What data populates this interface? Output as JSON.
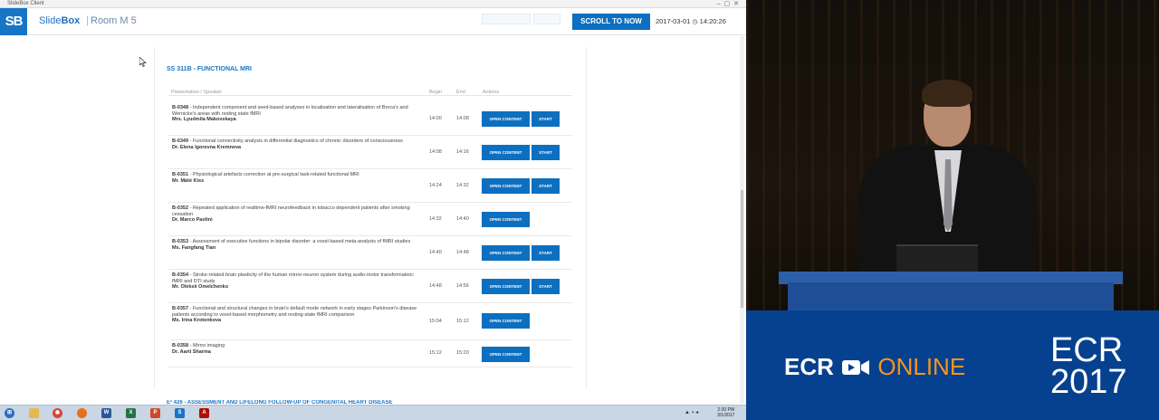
{
  "window": {
    "title": "SlideBox Client"
  },
  "header": {
    "logo": "SB",
    "app_name_prefix": "Slide",
    "app_name_suffix": "Box",
    "separator": "|",
    "room": "Room M 5",
    "scroll_button": "SCROLL TO NOW",
    "date": "2017-03-01",
    "clock_icon": "◷",
    "time": "14:20:26"
  },
  "session": {
    "title": "SS 311B - FUNCTIONAL MRI",
    "columns": [
      "Presentation / Speaker",
      "Begin",
      "End",
      "Actions"
    ],
    "open_label": "OPEN CONTENT",
    "start_label": "START",
    "rows": [
      {
        "code": "B-0348",
        "title": "Independent component and seed-based analyses in localisation and lateralisation of Broca's and Wernicke's areas with resting state fMRI",
        "speaker": "Mrs. Lyudmila Makovskaya",
        "begin": "14:00",
        "end": "14:08",
        "has_start": true
      },
      {
        "code": "B-0349",
        "title": "Functional connectivity analysis in differential diagnostics of chronic disorders of consciousness",
        "speaker": "Dr. Elena Igorevna Kremneva",
        "begin": "14:08",
        "end": "14:16",
        "has_start": true
      },
      {
        "code": "B-0351",
        "title": "Physiological artefacts correction at pre-surgical task-related functional MRI",
        "speaker": "Mr. Máté Kiss",
        "begin": "14:24",
        "end": "14:32",
        "has_start": true
      },
      {
        "code": "B-0352",
        "title": "Repeated application of realtime-fMRI neurofeedback in tobacco dependent patients after smoking cessation",
        "speaker": "Dr. Marco Paolini",
        "begin": "14:32",
        "end": "14:40",
        "has_start": false
      },
      {
        "code": "B-0353",
        "title": "Assessment of executive functions in bipolar disorder: a voxel-based meta-analysis of fMRI studies",
        "speaker": "Ms. Fangfang Tian",
        "begin": "14:40",
        "end": "14:48",
        "has_start": true
      },
      {
        "code": "B-0354",
        "title": "Stroke-related brain plasticity of the human mirror-neuron system during audio-motor transformation: fMRI and DTI study",
        "speaker": "Mr. Oleksii Omelchenko",
        "begin": "14:48",
        "end": "14:56",
        "has_start": true
      },
      {
        "code": "B-0357",
        "title": "Functional and structural changes in brain's default mode network in early stages Parkinson's disease patients according to voxel-based morphometry and resting-state fMRI comparison",
        "speaker": "Ms. Irina Krotenkova",
        "begin": "15:04",
        "end": "15:12",
        "has_start": false
      },
      {
        "code": "B-0358",
        "title": "Mirror imaging",
        "speaker": "Dr. Aarti Sharma",
        "begin": "15:12",
        "end": "15:20",
        "has_start": false
      }
    ]
  },
  "next_session": {
    "title": "E³ 426 - ASSESSMENT AND LIFELONG FOLLOW-UP OF CONGENITAL HEART DISEASE"
  },
  "taskbar": {
    "time": "2:20 PM",
    "date": "3/1/2017",
    "icons": [
      "start-orb-icon",
      "explorer-icon",
      "chrome-icon",
      "firefox-icon",
      "word-icon",
      "excel-icon",
      "powerpoint-icon",
      "slidebox-icon",
      "acrobat-icon"
    ]
  },
  "branding": {
    "ecr": "ECR",
    "online": "ONLINE",
    "year_line1": "ECR",
    "year_line2": "2017",
    "accent": "#f7941d",
    "background": "#06418f"
  },
  "colors": {
    "primary_button": "#0d6fc0",
    "link": "#1975c4",
    "logo_bg": "#1875c6"
  }
}
